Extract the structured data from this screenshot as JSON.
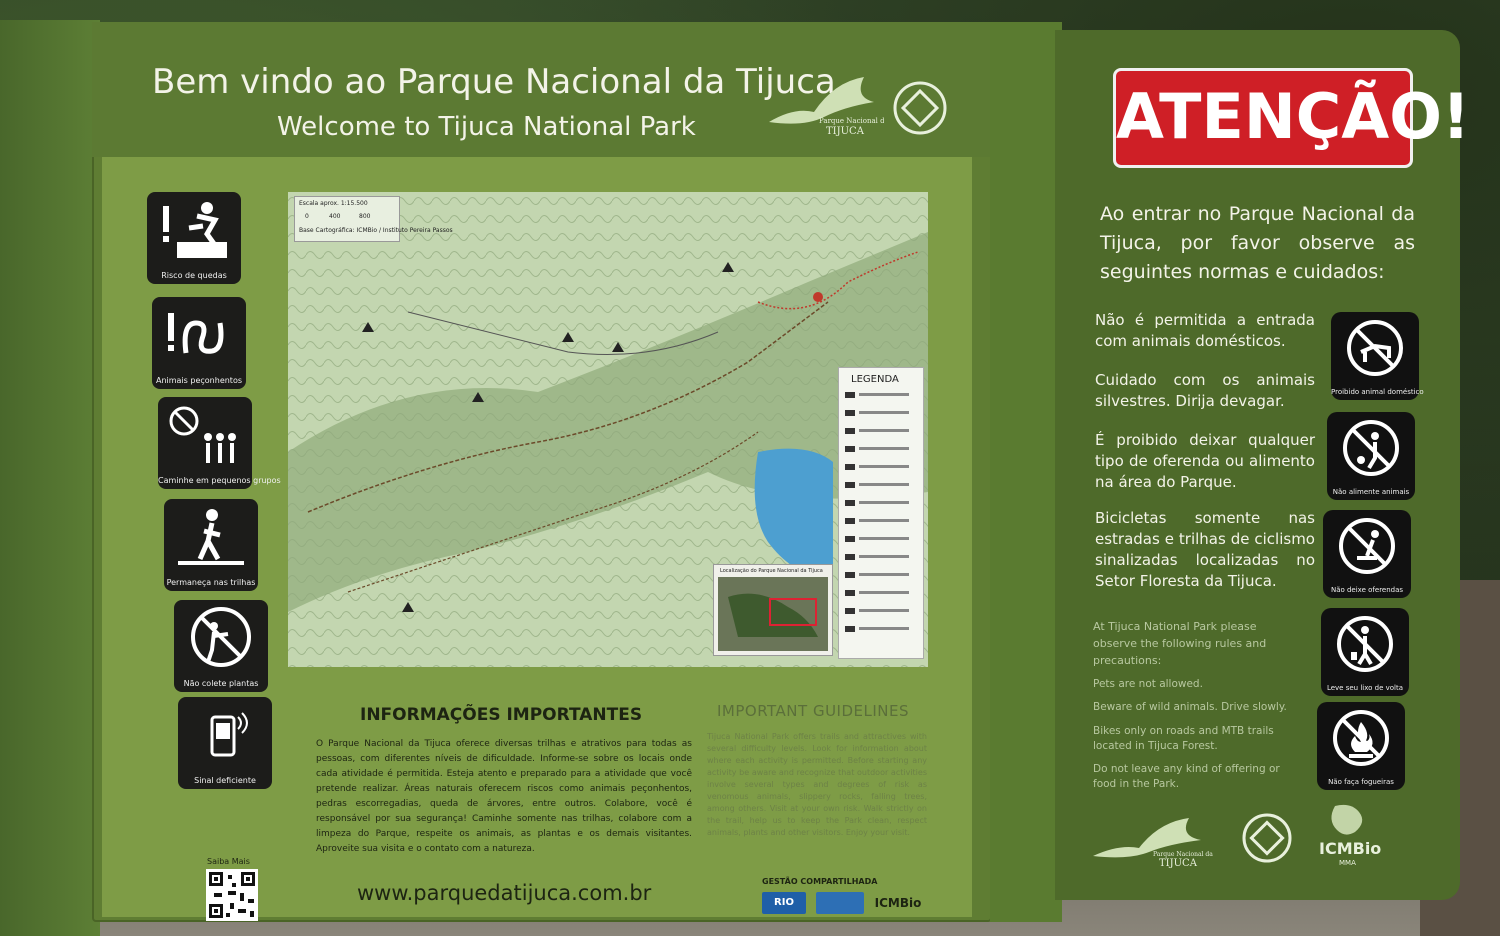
{
  "main_board": {
    "title_pt": "Bem vindo ao Parque Nacional da Tijuca",
    "title_en": "Welcome to Tijuca National Park",
    "logo_text": "Parque Nacional da TIJUCA"
  },
  "warning_icons": [
    {
      "name": "fall-risk",
      "caption": "Risco de quedas"
    },
    {
      "name": "venomous-animals",
      "caption": "Animais peçonhentos"
    },
    {
      "name": "small-groups",
      "caption": "Caminhe em pequenos grupos"
    },
    {
      "name": "stay-on-trails",
      "caption": "Permaneça nas trilhas"
    },
    {
      "name": "no-plant-collecting",
      "caption": "Não colete plantas"
    },
    {
      "name": "weak-signal",
      "caption": "Sinal deficiente"
    }
  ],
  "map": {
    "scale_title": "Escala aprox. 1:15.500",
    "scale_ticks": [
      "0",
      "400",
      "800"
    ],
    "base": "Base Cartográfica: ICMBio / Instituto Pereira Passos",
    "legend_title": "LEGENDA",
    "inset_title": "Localização do Parque Nacional da Tijuca"
  },
  "info": {
    "title": "INFORMAÇÕES IMPORTANTES",
    "body": "O Parque Nacional da Tijuca oferece diversas trilhas e atrativos para todas as pessoas, com diferentes níveis de dificuldade. Informe-se sobre os locais onde cada atividade é permitida. Esteja atento e preparado para a atividade que você pretende realizar. Áreas naturais oferecem riscos como animais peçonhentos, pedras escorregadias, queda de árvores, entre outros. Colabore, você é responsável por sua segurança! Caminhe somente nas trilhas, colabore com a limpeza do Parque, respeite os animais, as plantas e os demais visitantes. Aproveite sua visita e o contato com a natureza."
  },
  "guidelines": {
    "title": "IMPORTANT GUIDELINES",
    "body": "Tijuca National Park offers trails and attractives with several difficulty levels. Look for information about where each activity is permitted. Before starting any activity be aware and recognize that outdoor activities involve several types and degrees of risk as venomous animals, slippery rocks, falling trees, among others. Visit at your own risk. Walk strictly on the trail, help us to keep the Park clean, respect animals, plants and other visitors. Enjoy your visit."
  },
  "footer": {
    "url": "www.parquedatijuca.com.br",
    "saiba_mais": "Saiba Mais",
    "gestao": "GESTÃO COMPARTILHADA",
    "partners": [
      "RIO",
      "ICMBio"
    ]
  },
  "attention_board": {
    "heading": "ATENÇÃO!",
    "intro": "Ao entrar no Parque Nacional da Tijuca, por favor observe as seguintes normas e cuidados:",
    "rules": [
      "Não é permitida a entrada com animais domésticos.",
      "Cuidado com os animais silvestres. Dirija devagar.",
      "É proibido deixar qualquer tipo de oferenda ou alimento na área do Parque.",
      "Bicicletas somente nas estradas e trilhas de ciclismo sinalizadas localizadas no Setor Floresta da Tijuca."
    ],
    "rule_icons": [
      {
        "name": "no-pets",
        "caption": "Proibido animal doméstico"
      },
      {
        "name": "no-feeding",
        "caption": "Não alimente animais"
      },
      {
        "name": "no-offerings",
        "caption": "Não deixe oferendas"
      },
      {
        "name": "take-trash",
        "caption": "Leve seu lixo de volta"
      },
      {
        "name": "no-fires",
        "caption": "Não faça fogueiras"
      }
    ],
    "en_intro": "At Tijuca National Park please observe the following rules and precautions:",
    "en_rules": [
      "Pets are not allowed.",
      "Beware of wild animals. Drive slowly.",
      "Bikes only on roads and MTB trails located in Tijuca Forest.",
      "Do not leave any kind of offering or food in the Park."
    ],
    "logos": [
      "Parque Nacional da TIJUCA",
      "ICMBio",
      "MMA"
    ]
  },
  "colors": {
    "board_green": "#5f7d33",
    "panel_green": "#7e9c46",
    "attention_red": "#cf1f26",
    "right_board": "#4e6a2a"
  }
}
